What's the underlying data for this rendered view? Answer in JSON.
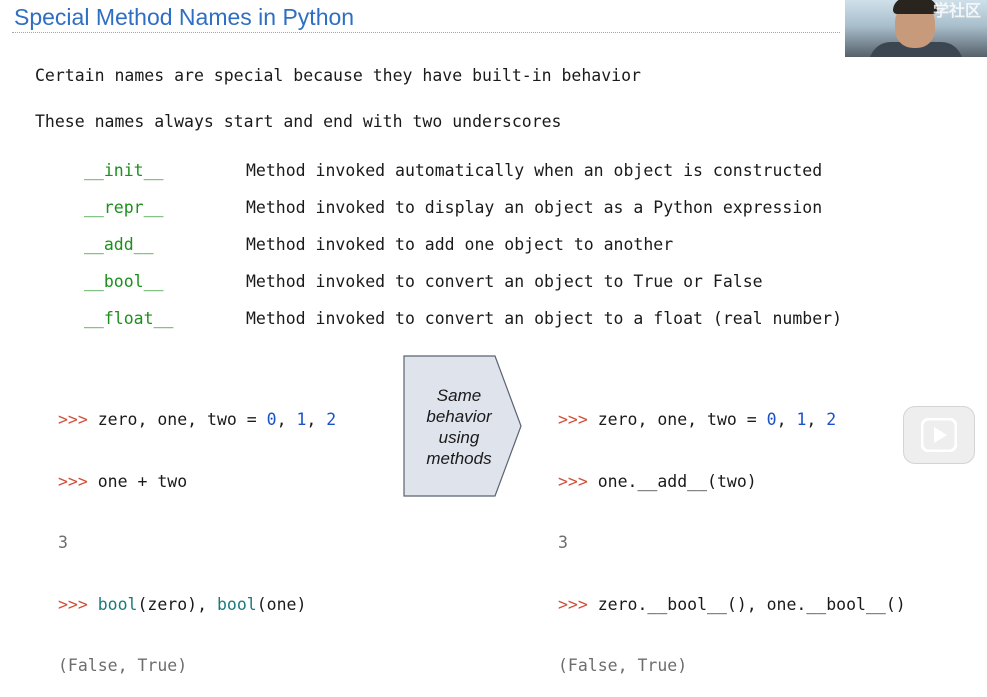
{
  "title": "Special Method Names in Python",
  "watermark": "学社区",
  "intro": [
    "Certain names are special because they have built-in behavior",
    "These names always start and end with two underscores"
  ],
  "methods": [
    {
      "name": "__init__",
      "desc": "Method invoked automatically when an object is constructed"
    },
    {
      "name": "__repr__",
      "desc": "Method invoked to display an object as a Python expression"
    },
    {
      "name": "__add__",
      "desc": "Method invoked to add one object to another"
    },
    {
      "name": "__bool__",
      "desc": "Method invoked to convert an object to True or False"
    },
    {
      "name": "__float__",
      "desc": "Method invoked to convert an object to a float (real number)"
    }
  ],
  "left_code": {
    "prompt": ">>>",
    "l1_a": "zero, one, two = ",
    "l1_n0": "0",
    "l1_c1": ", ",
    "l1_n1": "1",
    "l1_c2": ", ",
    "l1_n2": "2",
    "l2": "one + two",
    "l3": "3",
    "l4_f1": "bool",
    "l4_a1": "(zero), ",
    "l4_f2": "bool",
    "l4_a2": "(one)",
    "l5": "(False, True)"
  },
  "arrow_lines": [
    "Same",
    "behavior",
    "using",
    "methods"
  ],
  "right_code": {
    "prompt": ">>>",
    "l1_a": "zero, one, two = ",
    "l1_n0": "0",
    "l1_c1": ", ",
    "l1_n1": "1",
    "l1_c2": ", ",
    "l1_n2": "2",
    "l2": "one.__add__(two)",
    "l3": "3",
    "l4": "zero.__bool__(), one.__bool__()",
    "l5": "(False, True)"
  },
  "colors": {
    "title": "#2f6fc3",
    "method_name": "#1d8f1d",
    "prompt": "#d0503a",
    "number": "#1a52c8",
    "output": "#6d6d6d"
  },
  "icons": {
    "webcam": "presenter-video",
    "play": "play-icon"
  }
}
